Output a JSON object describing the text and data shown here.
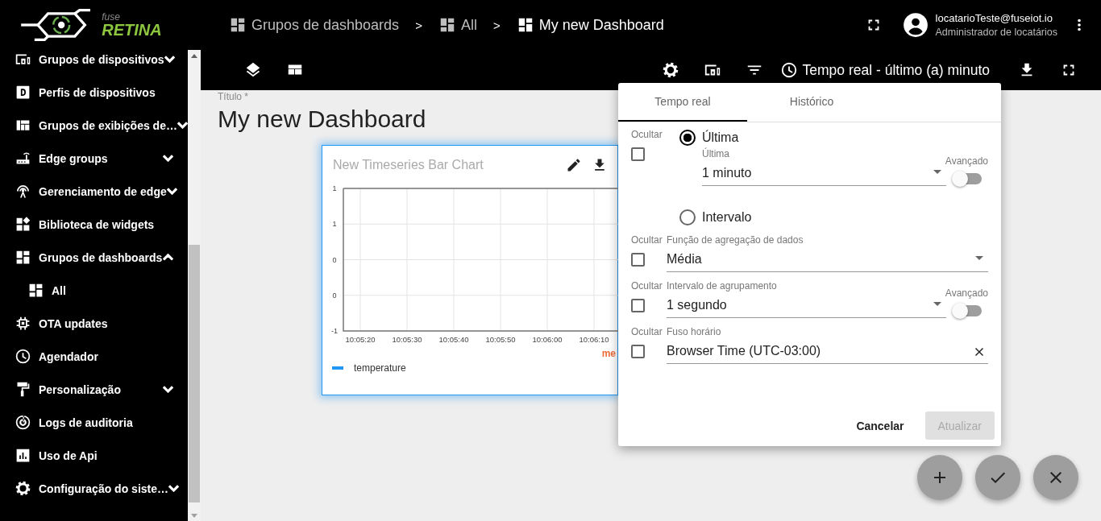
{
  "logo": {
    "small": "fuse",
    "big": "RETINA"
  },
  "breadcrumbs": [
    {
      "label": "Grupos de dashboards",
      "selected": false
    },
    {
      "label": "All",
      "selected": false
    },
    {
      "label": "My new Dashboard",
      "selected": true
    }
  ],
  "breadcrumb_separator": ">",
  "user": {
    "email": "locatarioTeste@fuseiot.io",
    "role": "Administrador de locatários"
  },
  "sidebar": {
    "items": [
      {
        "label": "Grupos de dispositivos",
        "kind": "group",
        "expanded": false
      },
      {
        "label": "Perfis de dispositivos",
        "kind": "link"
      },
      {
        "label": "Grupos de exibições de…",
        "kind": "group",
        "expanded": false
      },
      {
        "label": "Edge groups",
        "kind": "group",
        "expanded": false
      },
      {
        "label": "Gerenciamento de edge",
        "kind": "group",
        "expanded": false
      },
      {
        "label": "Biblioteca de widgets",
        "kind": "link"
      },
      {
        "label": "Grupos de dashboards",
        "kind": "group",
        "expanded": true,
        "children": [
          {
            "label": "All",
            "kind": "link"
          }
        ]
      },
      {
        "label": "OTA updates",
        "kind": "link"
      },
      {
        "label": "Agendador",
        "kind": "link"
      },
      {
        "label": "Personalização",
        "kind": "group",
        "expanded": false
      },
      {
        "label": "Logs de auditoria",
        "kind": "link"
      },
      {
        "label": "Uso de Api",
        "kind": "link"
      },
      {
        "label": "Configuração do siste…",
        "kind": "group",
        "expanded": false
      }
    ]
  },
  "toolbar": {
    "timewindow": "Tempo real - último (a) minuto"
  },
  "dashboard": {
    "title_label": "Título *",
    "title": "My new Dashboard"
  },
  "widget": {
    "title": "New Timeseries Bar Chart",
    "cut_label": "me",
    "chart_data": {
      "type": "bar",
      "grid": true,
      "categories": [
        "10:05:20",
        "10:05:30",
        "10:05:40",
        "10:05:50",
        "10:06:00",
        "10:06:10"
      ],
      "ylim": [
        -1,
        1
      ],
      "yticks": [
        {
          "value": 1,
          "label": "1"
        },
        {
          "value": 0.5,
          "label": "1"
        },
        {
          "value": 0,
          "label": "0"
        },
        {
          "value": -0.5,
          "label": "0"
        },
        {
          "value": -1,
          "label": "-1"
        }
      ],
      "series": [
        {
          "name": "temperature",
          "color": "#2196f3",
          "values": [
            null,
            null,
            null,
            null,
            null,
            null
          ]
        }
      ]
    }
  },
  "timewindow_dialog": {
    "tabs": [
      {
        "label": "Tempo real",
        "selected": true
      },
      {
        "label": "Histórico",
        "selected": false
      }
    ],
    "window_section": {
      "hide_label": "Ocultar",
      "hide_checked": false,
      "modes": [
        {
          "label": "Última",
          "selected": true
        },
        {
          "label": "Intervalo",
          "selected": false
        }
      ],
      "last_field": {
        "label": "Última",
        "value": "1 minuto"
      },
      "advanced": {
        "label": "Avançado",
        "on": false
      }
    },
    "fields": [
      {
        "hide_label": "Ocultar",
        "hide_checked": false,
        "label": "Função de agregação de dados",
        "value": "Média",
        "kind": "select"
      },
      {
        "hide_label": "Ocultar",
        "hide_checked": false,
        "label": "Intervalo de agrupamento",
        "value": "1 segundo",
        "kind": "select",
        "advanced": {
          "label": "Avançado",
          "on": false
        }
      },
      {
        "hide_label": "Ocultar",
        "hide_checked": false,
        "label": "Fuso horário",
        "value": "Browser Time (UTC-03:00)",
        "kind": "clearable"
      }
    ],
    "buttons": [
      {
        "label": "Cancelar",
        "disabled": false
      },
      {
        "label": "Atualizar",
        "disabled": true
      }
    ]
  }
}
